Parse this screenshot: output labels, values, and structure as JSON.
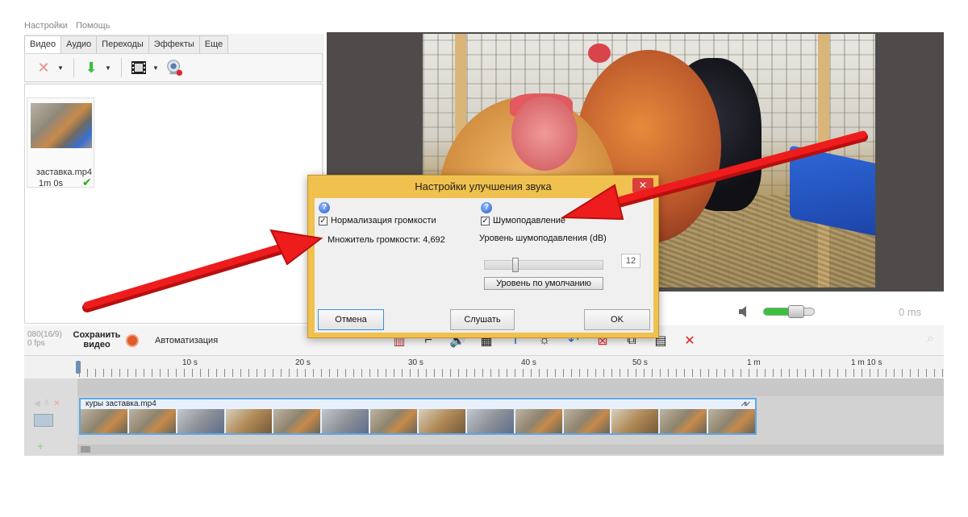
{
  "menu": {
    "items": [
      "Настройки",
      "Помощь"
    ]
  },
  "left_panel": {
    "tabs": [
      "Видео",
      "Аудио",
      "Переходы",
      "Эффекты",
      "Еще"
    ],
    "clip": {
      "name": "заставка.mp4",
      "duration": "1m 0s"
    }
  },
  "preview": {
    "time": "0 ms"
  },
  "timeline_toolbar": {
    "format_line1": "080(16/9)",
    "format_line2": "0 fps",
    "save_label_line1": "Сохранить",
    "save_label_line2": "видео",
    "auto_label": "Автоматизация"
  },
  "ruler": {
    "labels": [
      "10 s",
      "20 s",
      "30 s",
      "40 s",
      "50 s",
      "1 m",
      "1 m 10 s"
    ]
  },
  "track": {
    "clip_title": "куры заставка.mp4"
  },
  "dialog": {
    "title": "Настройки улучшения звука",
    "close": "✕",
    "normalize_label": "Нормализация громкости",
    "multiplier_text": "Множитель громкости: 4,692",
    "noise_label": "Шумоподавление",
    "noise_level_label": "Уровень шумоподавления (dB)",
    "noise_level_value": "12",
    "default_button": "Уровень по умолчанию",
    "cancel_button": "Отмена",
    "listen_button": "Слушать",
    "ok_button": "OK",
    "normalize_checked": true,
    "noise_checked": true,
    "noise_level_fraction": 0.25
  },
  "colors": {
    "dialog_title_bg": "#f0c14e",
    "arrow": "#ee1c1c",
    "check_green": "#2aa31e"
  },
  "icons": [
    "delete-icon",
    "import-arrow-icon",
    "film-icon",
    "webcam-icon",
    "speaker-icon",
    "record-icon",
    "zoom-icon",
    "question-icon",
    "waveform-icon"
  ]
}
